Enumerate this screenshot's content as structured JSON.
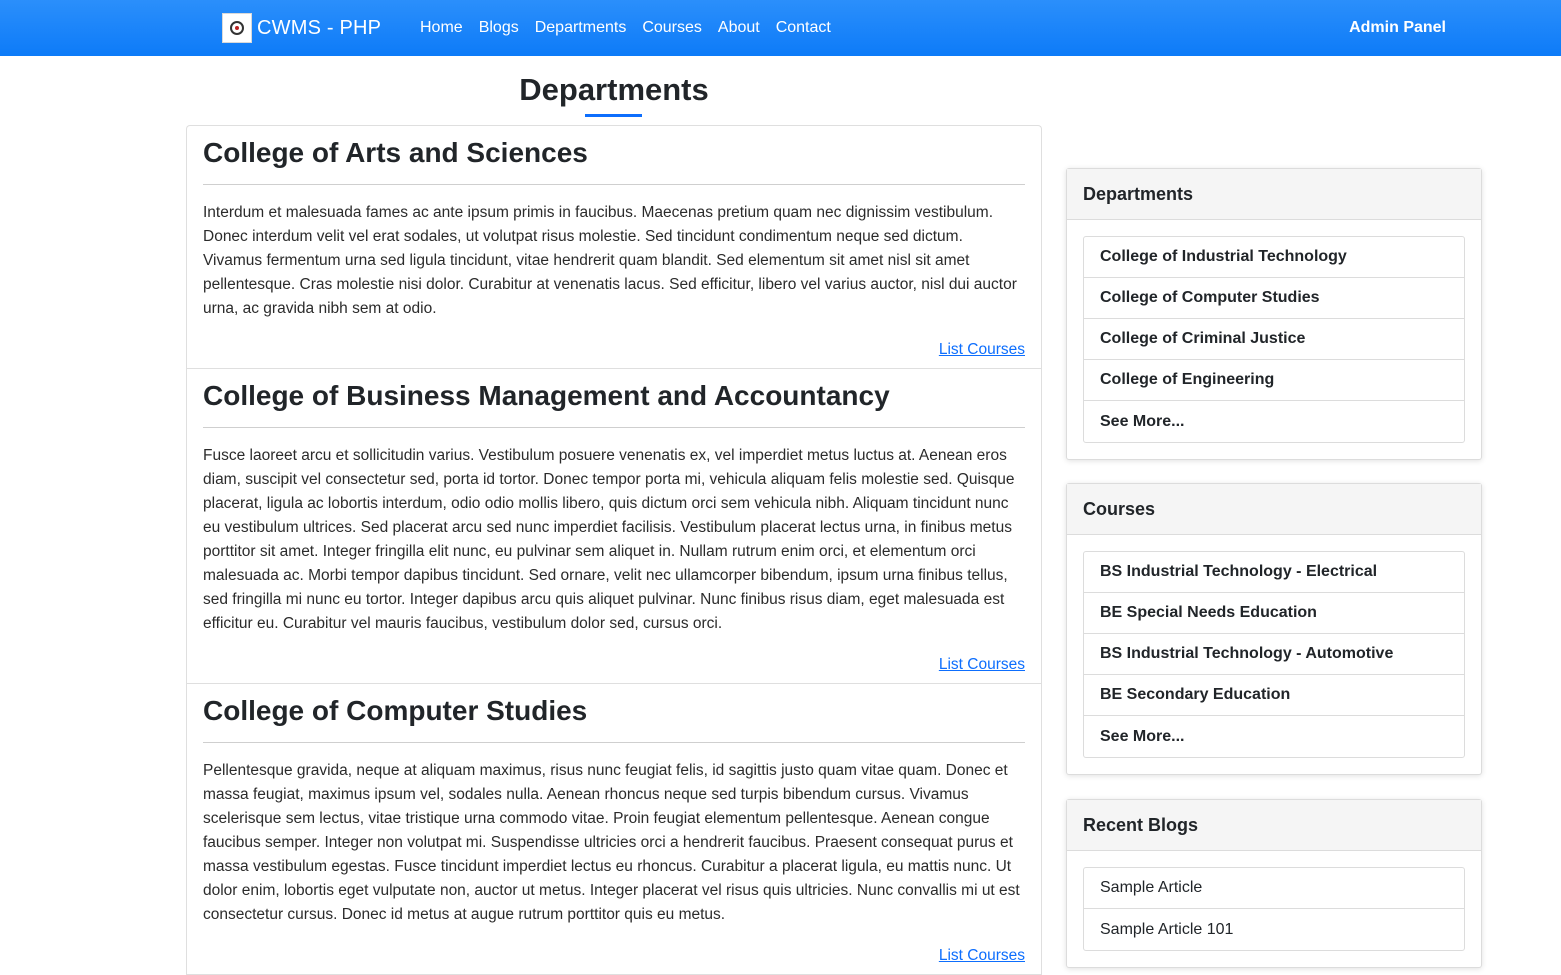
{
  "navbar": {
    "brand": "CWMS - PHP",
    "links": [
      "Home",
      "Blogs",
      "Departments",
      "Courses",
      "About",
      "Contact"
    ],
    "admin": "Admin Panel"
  },
  "page": {
    "title": "Departments"
  },
  "departments": [
    {
      "name": "College of Arts and Sciences",
      "description": "Interdum et malesuada fames ac ante ipsum primis in faucibus. Maecenas pretium quam nec dignissim vestibulum. Donec interdum velit vel erat sodales, ut volutpat risus molestie. Sed tincidunt condimentum neque sed dictum. Vivamus fermentum urna sed ligula tincidunt, vitae hendrerit quam blandit. Sed elementum sit amet nisl sit amet pellentesque. Cras molestie nisi dolor. Curabitur at venenatis lacus. Sed efficitur, libero vel varius auctor, nisl dui auctor urna, ac gravida nibh sem at odio.",
      "link": "List Courses"
    },
    {
      "name": "College of Business Management and Accountancy",
      "description": "Fusce laoreet arcu et sollicitudin varius. Vestibulum posuere venenatis ex, vel imperdiet metus luctus at. Aenean eros diam, suscipit vel consectetur sed, porta id tortor. Donec tempor porta mi, vehicula aliquam felis molestie sed. Quisque placerat, ligula ac lobortis interdum, odio odio mollis libero, quis dictum orci sem vehicula nibh. Aliquam tincidunt nunc eu vestibulum ultrices. Sed placerat arcu sed nunc imperdiet facilisis. Vestibulum placerat lectus urna, in finibus metus porttitor sit amet. Integer fringilla elit nunc, eu pulvinar sem aliquet in. Nullam rutrum enim orci, et elementum orci malesuada ac. Morbi tempor dapibus tincidunt. Sed ornare, velit nec ullamcorper bibendum, ipsum urna finibus tellus, sed fringilla mi nunc eu tortor. Integer dapibus arcu quis aliquet pulvinar. Nunc finibus risus diam, eget malesuada est efficitur eu. Curabitur vel mauris faucibus, vestibulum dolor sed, cursus orci.",
      "link": "List Courses"
    },
    {
      "name": "College of Computer Studies",
      "description": "Pellentesque gravida, neque at aliquam maximus, risus nunc feugiat felis, id sagittis justo quam vitae quam. Donec et massa feugiat, maximus ipsum vel, sodales nulla. Aenean rhoncus neque sed turpis bibendum cursus. Vivamus scelerisque sem lectus, vitae tristique urna commodo vitae. Proin feugiat elementum pellentesque. Aenean congue faucibus semper. Integer non volutpat mi. Suspendisse ultricies orci a hendrerit faucibus. Praesent consequat purus et massa vestibulum egestas. Fusce tincidunt imperdiet lectus eu rhoncus. Curabitur a placerat ligula, eu mattis nunc. Ut dolor enim, lobortis eget vulputate non, auctor ut metus. Integer placerat vel risus quis ultricies. Nunc convallis mi ut est consectetur cursus. Donec id metus at augue rutrum porttitor quis eu metus.",
      "link": "List Courses"
    }
  ],
  "sidebar": {
    "departments": {
      "title": "Departments",
      "items": [
        "College of Industrial Technology",
        "College of Computer Studies",
        "College of Criminal Justice",
        "College of Engineering",
        "See More..."
      ]
    },
    "courses": {
      "title": "Courses",
      "items": [
        "BS Industrial Technology - Electrical",
        "BE Special Needs Education",
        "BS Industrial Technology - Automotive",
        "BE Secondary Education",
        "See More..."
      ]
    },
    "blogs": {
      "title": "Recent Blogs",
      "items": [
        "Sample Article",
        "Sample Article 101"
      ]
    }
  }
}
